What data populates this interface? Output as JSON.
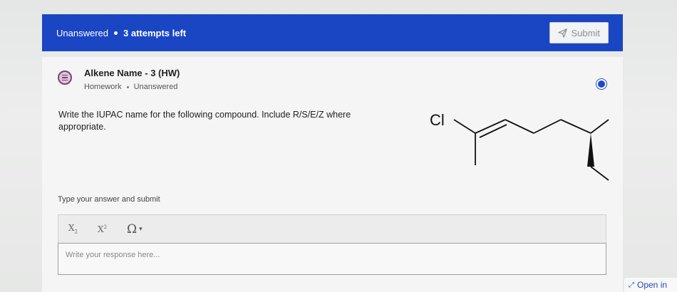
{
  "banner": {
    "status": "Unanswered",
    "attempts": "3 attempts left",
    "submit_label": "Submit"
  },
  "question": {
    "title": "Alkene Name - 3 (HW)",
    "type": "Homework",
    "status": "Unanswered",
    "prompt": "Write the IUPAC name for the following compound. Include R/S/E/Z where appropriate.",
    "molecule_label": "Cl"
  },
  "answer": {
    "label": "Type your answer and submit",
    "toolbar": {
      "subscript": "X",
      "superscript": "X",
      "omega": "Ω"
    },
    "placeholder": "Write your response here..."
  },
  "footer": {
    "open_in": "Open in"
  },
  "colors": {
    "banner": "#1a46c4",
    "icon_accent": "#7f3f77"
  },
  "icons": [
    "paper-plane-icon",
    "question-icon",
    "radio-icon",
    "omega-icon",
    "expand-arrow-icon"
  ]
}
